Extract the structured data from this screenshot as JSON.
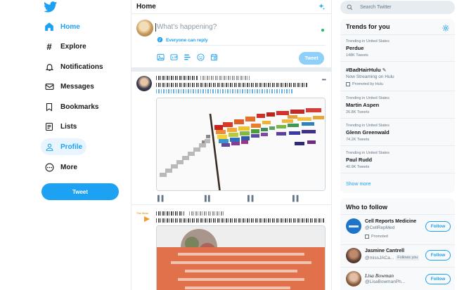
{
  "nav": {
    "items": [
      {
        "label": "Home",
        "icon": "home-icon"
      },
      {
        "label": "Explore",
        "icon": "hashtag-icon"
      },
      {
        "label": "Notifications",
        "icon": "bell-icon"
      },
      {
        "label": "Messages",
        "icon": "envelope-icon"
      },
      {
        "label": "Bookmarks",
        "icon": "bookmark-icon"
      },
      {
        "label": "Lists",
        "icon": "list-icon"
      },
      {
        "label": "Profile",
        "icon": "person-icon"
      },
      {
        "label": "More",
        "icon": "more-circle-icon"
      }
    ],
    "active": "Profile",
    "tweet_button": "Tweet"
  },
  "main": {
    "title": "Home",
    "compose": {
      "placeholder": "What's happening?",
      "reply_setting": "Everyone can reply",
      "submit": "Tweet"
    },
    "posts": [
      {
        "avatar": "portrait-avatar"
      },
      {
        "avatar": "brand-avatar",
        "avatar_text": "The Bear"
      }
    ]
  },
  "search": {
    "placeholder": "Search Twitter"
  },
  "trends": {
    "title": "Trends for you",
    "items": [
      {
        "context": "Trending in United States",
        "name": "Perdue",
        "count": "148K Tweets"
      },
      {
        "context": "",
        "name": "#BadHairHulu",
        "sub": "Now Streaming on Hulu",
        "promoted": "Promoted by Hulu"
      },
      {
        "context": "Trending in United States",
        "name": "Martin Aspen",
        "count": "26.8K Tweets"
      },
      {
        "context": "Trending in United States",
        "name": "Glenn Greenwald",
        "count": "74.2K Tweets"
      },
      {
        "context": "Trending in United States",
        "name": "Paul Rudd",
        "count": "40.9K Tweets"
      }
    ],
    "show_more": "Show more"
  },
  "who_to_follow": {
    "title": "Who to follow",
    "accounts": [
      {
        "name": "Cell Reports Medicine",
        "handle": "@CellRepMed",
        "note": "Promoted",
        "button": "Follow"
      },
      {
        "name": "Jasmine Cantrell",
        "handle": "@missJACa...",
        "badge": "Follows you",
        "button": "Follow"
      },
      {
        "name": "Lisa Bowman",
        "handle": "@LisaBowmanPh...",
        "button": "Follow"
      }
    ]
  },
  "colors": {
    "accent": "#1da1f2",
    "text": "#14171a",
    "muted": "#657786",
    "border": "#e6ecf0",
    "panel": "#f7f9fa"
  }
}
